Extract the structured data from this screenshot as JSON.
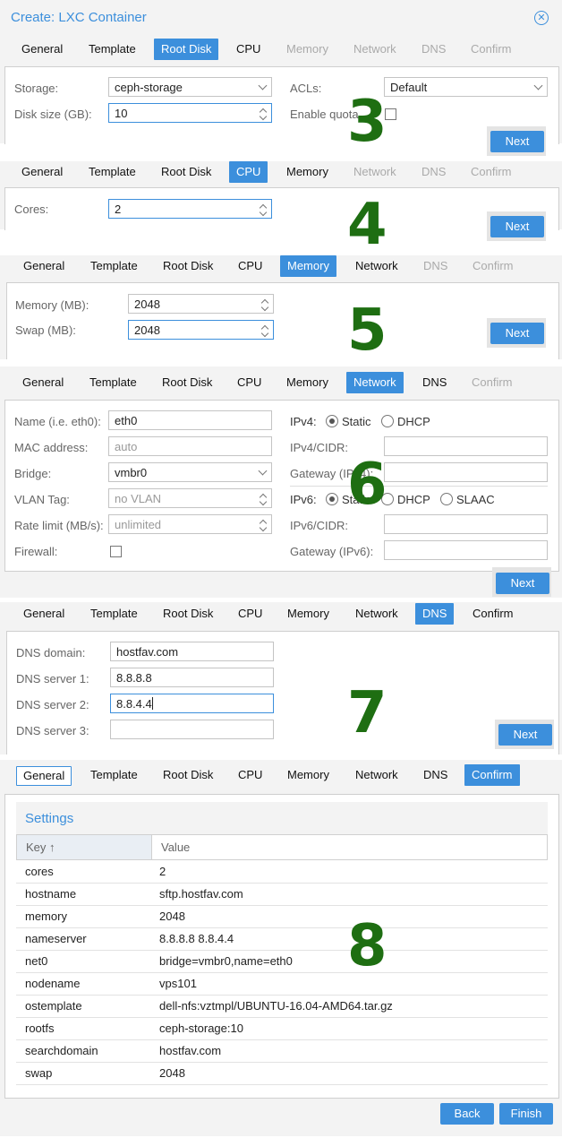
{
  "window": {
    "title": "Create: LXC Container"
  },
  "tab_labels": [
    "General",
    "Template",
    "Root Disk",
    "CPU",
    "Memory",
    "Network",
    "DNS",
    "Confirm"
  ],
  "step_numbers": [
    "3",
    "4",
    "5",
    "6",
    "7",
    "8"
  ],
  "buttons": {
    "next": "Next",
    "back": "Back",
    "finish": "Finish"
  },
  "root_disk": {
    "storage_label": "Storage:",
    "storage_value": "ceph-storage",
    "acls_label": "ACLs:",
    "acls_value": "Default",
    "disk_size_label": "Disk size (GB):",
    "disk_size_value": "10",
    "enable_quota_label": "Enable quota"
  },
  "cpu": {
    "cores_label": "Cores:",
    "cores_value": "2"
  },
  "memory": {
    "memory_label": "Memory (MB):",
    "memory_value": "2048",
    "swap_label": "Swap (MB):",
    "swap_value": "2048"
  },
  "network": {
    "name_label": "Name (i.e. eth0):",
    "name_value": "eth0",
    "mac_label": "MAC address:",
    "mac_placeholder": "auto",
    "bridge_label": "Bridge:",
    "bridge_value": "vmbr0",
    "vlan_label": "VLAN Tag:",
    "vlan_placeholder": "no VLAN",
    "rate_label": "Rate limit (MB/s):",
    "rate_placeholder": "unlimited",
    "firewall_label": "Firewall:",
    "ipv4_label": "IPv4:",
    "static_label": "Static",
    "dhcp_label": "DHCP",
    "ipv4_cidr_label": "IPv4/CIDR:",
    "gateway_ipv4_label": "Gateway (IPv4):",
    "ipv6_label": "IPv6:",
    "slaac_label": "SLAAC",
    "ipv6_cidr_label": "IPv6/CIDR:",
    "gateway_ipv6_label": "Gateway (IPv6):"
  },
  "dns": {
    "domain_label": "DNS domain:",
    "domain_value": "hostfav.com",
    "server1_label": "DNS server 1:",
    "server1_value": "8.8.8.8",
    "server2_label": "DNS server 2:",
    "server2_value": "8.8.4.4",
    "server3_label": "DNS server 3:",
    "server3_value": ""
  },
  "confirm": {
    "section_title": "Settings",
    "col_key": "Key ↑",
    "col_value": "Value",
    "rows": [
      {
        "key": "cores",
        "value": "2"
      },
      {
        "key": "hostname",
        "value": "sftp.hostfav.com"
      },
      {
        "key": "memory",
        "value": "2048"
      },
      {
        "key": "nameserver",
        "value": "8.8.8.8 8.8.4.4"
      },
      {
        "key": "net0",
        "value": "bridge=vmbr0,name=eth0"
      },
      {
        "key": "nodename",
        "value": "vps101"
      },
      {
        "key": "ostemplate",
        "value": "dell-nfs:vztmpl/UBUNTU-16.04-AMD64.tar.gz"
      },
      {
        "key": "rootfs",
        "value": "ceph-storage:10"
      },
      {
        "key": "searchdomain",
        "value": "hostfav.com"
      },
      {
        "key": "swap",
        "value": "2048"
      }
    ]
  },
  "colors": {
    "accent": "#3c8fdc",
    "step_number": "#1e6e12"
  }
}
